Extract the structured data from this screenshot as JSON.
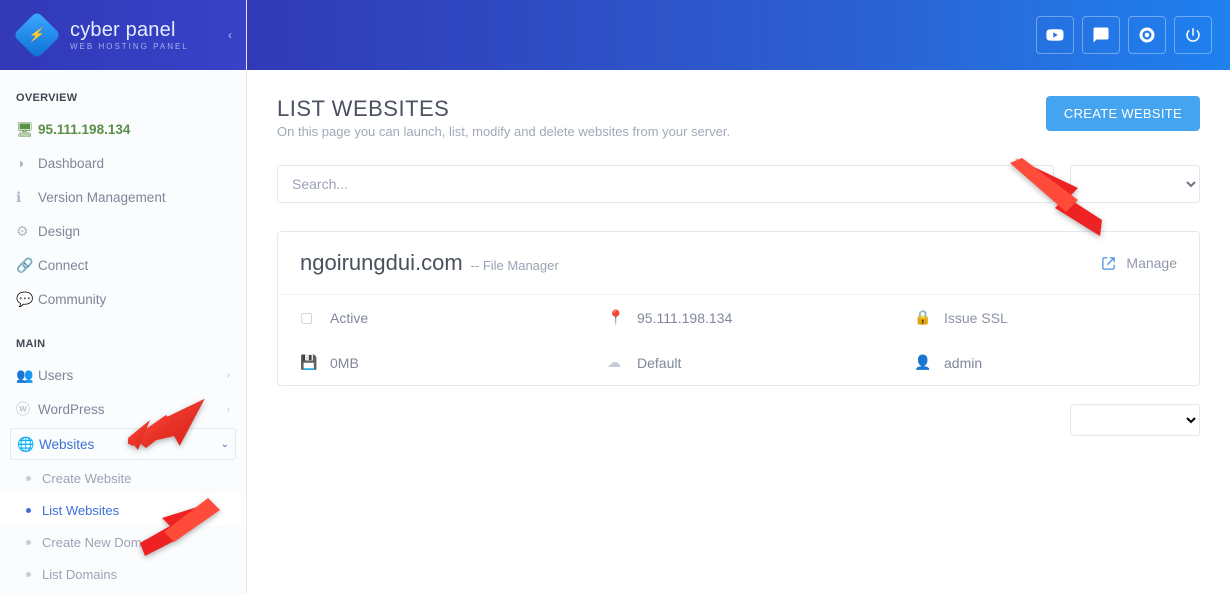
{
  "brand": {
    "title": "cyber panel",
    "subtitle": "WEB HOSTING PANEL"
  },
  "nav": {
    "overview_label": "OVERVIEW",
    "main_label": "MAIN",
    "ip": "95.111.198.134",
    "dashboard": "Dashboard",
    "version_management": "Version Management",
    "design": "Design",
    "connect": "Connect",
    "community": "Community",
    "users": "Users",
    "wordpress": "WordPress",
    "websites": "Websites",
    "sub": {
      "create_website": "Create Website",
      "list_websites": "List Websites",
      "create_new_domain": "Create New Domain",
      "list_domains": "List Domains"
    }
  },
  "page": {
    "title": "LIST WEBSITES",
    "subtitle": "On this page you can launch, list, modify and delete websites from your server.",
    "create_button": "CREATE WEBSITE",
    "search_placeholder": "Search..."
  },
  "site": {
    "domain": "ngoirungdui.com",
    "file_manager_label": "-- File Manager",
    "manage_label": "Manage",
    "status": "Active",
    "ip": "95.111.198.134",
    "ssl": "Issue SSL",
    "disk": "0MB",
    "package": "Default",
    "owner": "admin"
  }
}
